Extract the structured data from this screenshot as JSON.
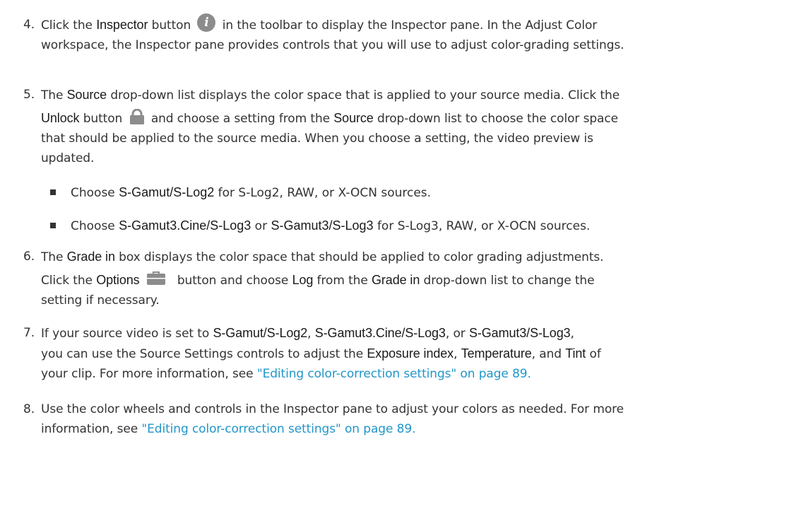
{
  "steps": [
    {
      "number": "4.",
      "lines": {
        "l1_a": "Click the ",
        "l1_kw1": "Inspector",
        "l1_b": " button ",
        "l1_c": " in the toolbar to display the Inspector pane. In the Adjust Color",
        "l2": "workspace, the Inspector pane provides controls that you will use to adjust color-grading settings."
      },
      "icon": "info-icon"
    },
    {
      "number": "5.",
      "lines": {
        "l1_kw": "Source",
        "l1_rest": " drop-down list displays the color space that is applied to your source media. Click the",
        "l1_pre": "The ",
        "l2_kw1": "Unlock",
        "l2_a": " button ",
        "l2_b": " and choose a setting from the ",
        "l2_kw2": "Source",
        "l2_c": " drop-down list to choose the color space",
        "l3": "that should be applied to the source media. When you choose a setting, the video preview is",
        "l4": "updated."
      },
      "icon": "lock-icon",
      "bullets": [
        {
          "pre": "Choose ",
          "kw1": "S-Gamut/S-Log2",
          "post": " for S-Log2, RAW, or X-OCN sources."
        },
        {
          "pre": "Choose ",
          "kw1": "S-Gamut3.Cine/S-Log3",
          "mid": " or ",
          "kw2": "S-Gamut3/S-Log3",
          "post": " for S-Log3, RAW, or X-OCN sources."
        }
      ]
    },
    {
      "number": "6.",
      "lines": {
        "l1_pre": "The ",
        "l1_kw": "Grade in",
        "l1_rest": " box displays the color space that should be applied to color grading adjustments.",
        "l2_a": "Click the ",
        "l2_kw1": "Options",
        "l2_b": " button and choose ",
        "l2_kw2": "Log",
        "l2_c": " from the ",
        "l2_kw3": "Grade in",
        "l2_d": " drop-down list to change the",
        "l3": "setting if necessary."
      },
      "icon": "briefcase-icon"
    },
    {
      "number": "7.",
      "lines": {
        "l1_a": "If your source video is set to ",
        "l1_kw1": "S-Gamut/S-Log2",
        "l1_b": ", ",
        "l1_kw2": "S-Gamut3.Cine/S-Log3",
        "l1_c": ", or ",
        "l1_kw3": "S-Gamut3/S-Log3",
        "l1_d": ",",
        "l2_a": "you can use the Source Settings controls to adjust the ",
        "l2_kw1": "Exposure index",
        "l2_b": ", ",
        "l2_kw2": "Temperature",
        "l2_c": ", and ",
        "l2_kw3": "Tint",
        "l2_d": " of",
        "l3_a": "your clip. For more information, see ",
        "l3_link": "\"Editing color-correction settings\" on page 89."
      }
    },
    {
      "number": "8.",
      "lines": {
        "l1": "Use the color wheels and controls in the Inspector pane to adjust your colors as needed. For more",
        "l2_a": "information, see ",
        "l2_link": "\"Editing color-correction settings\" on page 89."
      }
    }
  ],
  "colors": {
    "text": "#333333",
    "link": "#2196c9",
    "icon_gray": "#8c8c8c"
  }
}
